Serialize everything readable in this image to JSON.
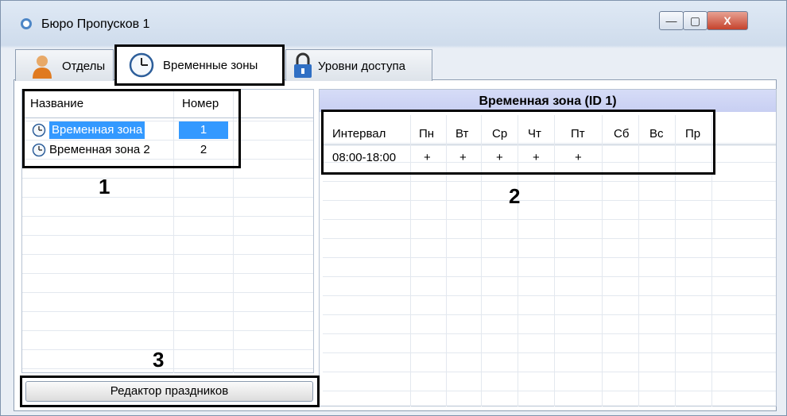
{
  "window": {
    "title": "Бюро Пропусков 1",
    "buttons": {
      "minimize": "—",
      "maximize": "▢",
      "close": "X"
    }
  },
  "tabs": [
    {
      "label": "Отделы",
      "icon": "person-icon"
    },
    {
      "label": "Временные зоны",
      "icon": "clock-icon",
      "active": true
    },
    {
      "label": "Уровни доступа",
      "icon": "lock-icon"
    }
  ],
  "zones_list": {
    "columns": [
      "Название",
      "Номер"
    ],
    "rows": [
      {
        "name": "Временная зона",
        "number": "1",
        "selected": true
      },
      {
        "name": "Временная зона 2",
        "number": "2",
        "selected": false
      }
    ]
  },
  "schedule": {
    "title": "Временная зона (ID 1)",
    "columns": [
      "Интервал",
      "Пн",
      "Вт",
      "Ср",
      "Чт",
      "Пт",
      "Сб",
      "Вс",
      "Пр"
    ],
    "rows": [
      [
        "08:00-18:00",
        "+",
        "+",
        "+",
        "+",
        "+",
        "",
        "",
        ""
      ]
    ]
  },
  "holiday_button": "Редактор праздников",
  "callouts": [
    "1",
    "2",
    "3"
  ],
  "colors": {
    "selection": "#3399ff",
    "header_bg": "#c8cff2"
  }
}
